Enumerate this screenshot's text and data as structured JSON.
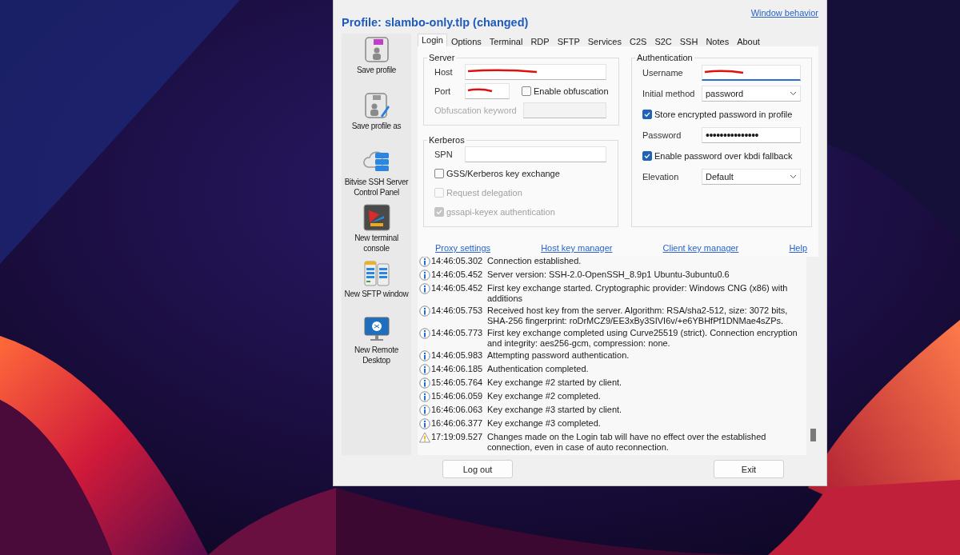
{
  "window": {
    "title": "Profile: slambo-only.tlp (changed)",
    "link": "Window behavior"
  },
  "sidebar": {
    "items": [
      {
        "label": "Save profile",
        "kind": "save"
      },
      {
        "label": "Save profile as",
        "kind": "saveas"
      },
      {
        "label": "Bitvise SSH Server Control Panel",
        "kind": "server"
      },
      {
        "label": "New terminal console",
        "kind": "terminal"
      },
      {
        "label": "New SFTP window",
        "kind": "sftp"
      },
      {
        "label": "New Remote Desktop",
        "kind": "remote"
      }
    ]
  },
  "tabs": [
    {
      "label": "Login",
      "selected": true
    },
    {
      "label": "Options",
      "selected": false
    },
    {
      "label": "Terminal",
      "selected": false
    },
    {
      "label": "RDP",
      "selected": false
    },
    {
      "label": "SFTP",
      "selected": false
    },
    {
      "label": "Services",
      "selected": false
    },
    {
      "label": "C2S",
      "selected": false
    },
    {
      "label": "S2C",
      "selected": false
    },
    {
      "label": "SSH",
      "selected": false
    },
    {
      "label": "Notes",
      "selected": false
    },
    {
      "label": "About",
      "selected": false
    }
  ],
  "server": {
    "title": "Server",
    "host": {
      "label": "Host",
      "redacted": true
    },
    "port": {
      "label": "Port",
      "redacted": true
    },
    "obfuscation": {
      "label": "Enable obfuscation",
      "checked": false
    },
    "keyword": {
      "label": "Obfuscation keyword",
      "disabled": true
    }
  },
  "kerberos": {
    "title": "Kerberos",
    "spn": {
      "label": "SPN"
    },
    "options": [
      {
        "label": "GSS/Kerberos key exchange",
        "checked": false,
        "disabled": false
      },
      {
        "label": "Request delegation",
        "checked": false,
        "disabled": true
      },
      {
        "label": "gssapi-keyex authentication",
        "checked": true,
        "disabled": true
      }
    ]
  },
  "authentication": {
    "title": "Authentication",
    "rows": [
      {
        "kind": "text",
        "label": "Username",
        "redacted": true,
        "focused": true
      },
      {
        "kind": "select",
        "label": "Initial method",
        "value": "password"
      },
      {
        "kind": "checkbox",
        "label": "Store encrypted password in profile",
        "checked": true
      },
      {
        "kind": "password",
        "label": "Password",
        "value": "•••••••••••••••"
      },
      {
        "kind": "checkbox",
        "label": "Enable password over kbdi fallback",
        "checked": true
      },
      {
        "kind": "select",
        "label": "Elevation",
        "value": "Default"
      }
    ]
  },
  "links": [
    "Proxy settings",
    "Host key manager",
    "Client key manager",
    "Help"
  ],
  "log": [
    {
      "kind": "info",
      "time": "14:46:05.302",
      "message": "Connection established."
    },
    {
      "kind": "info",
      "time": "14:46:05.452",
      "message": "Server version: SSH-2.0-OpenSSH_8.9p1 Ubuntu-3ubuntu0.6"
    },
    {
      "kind": "info",
      "time": "14:46:05.452",
      "message": "First key exchange started. Cryptographic provider: Windows CNG (x86) with additions"
    },
    {
      "kind": "info",
      "time": "14:46:05.753",
      "message": "Received host key from the server. Algorithm: RSA/sha2-512, size: 3072 bits, SHA-256 fingerprint: roDrMCZ9/EE3xBy3SIVI6v/+e6YBHfPf1DNMae4sZPs."
    },
    {
      "kind": "info",
      "time": "14:46:05.773",
      "message": "First key exchange completed using Curve25519 (strict). Connection encryption and integrity: aes256-gcm, compression: none."
    },
    {
      "kind": "info",
      "time": "14:46:05.983",
      "message": "Attempting password authentication."
    },
    {
      "kind": "info",
      "time": "14:46:06.185",
      "message": "Authentication completed."
    },
    {
      "kind": "info",
      "time": "15:46:05.764",
      "message": "Key exchange #2 started by client."
    },
    {
      "kind": "info",
      "time": "15:46:06.059",
      "message": "Key exchange #2 completed."
    },
    {
      "kind": "info",
      "time": "16:46:06.063",
      "message": "Key exchange #3 started by client."
    },
    {
      "kind": "info",
      "time": "16:46:06.377",
      "message": "Key exchange #3 completed."
    },
    {
      "kind": "warning",
      "time": "17:19:09.527",
      "message": "Changes made on the Login tab will have no effect over the established connection, even in case of auto reconnection."
    }
  ],
  "buttons": [
    {
      "label": "Log out"
    },
    {
      "label": "Exit"
    }
  ]
}
